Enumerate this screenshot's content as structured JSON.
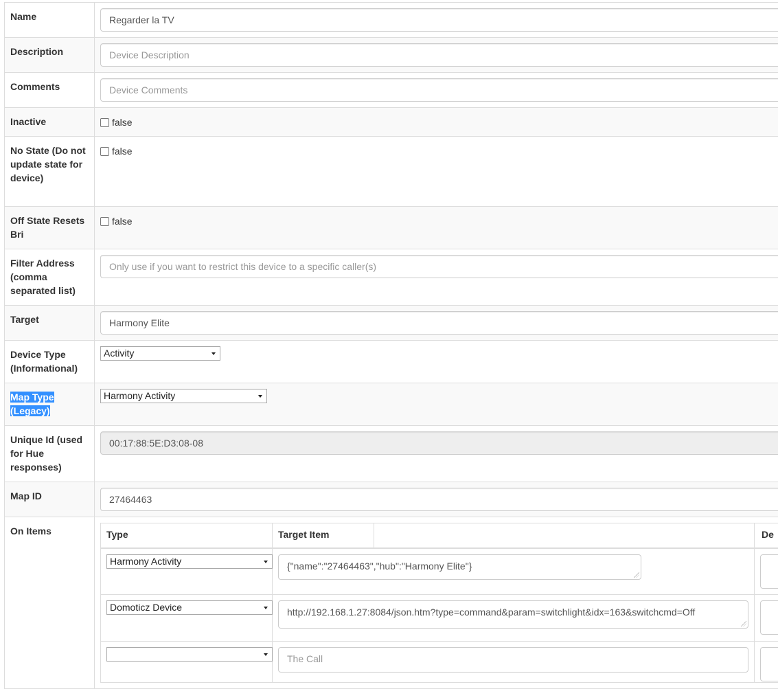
{
  "fields": {
    "name": {
      "label": "Name",
      "value": "Regarder la TV"
    },
    "description": {
      "label": "Description",
      "placeholder": "Device Description"
    },
    "comments": {
      "label": "Comments",
      "placeholder": "Device Comments"
    },
    "inactive": {
      "label": "Inactive",
      "value": "false"
    },
    "no_state": {
      "label": "No State (Do not update state for device)",
      "value": "false"
    },
    "off_state": {
      "label": "Off State Resets Bri",
      "value": "false"
    },
    "filter_address": {
      "label": "Filter Address (comma separated list)",
      "placeholder": "Only use if you want to restrict this device to a specific caller(s)"
    },
    "target": {
      "label": "Target",
      "value": "Harmony Elite"
    },
    "device_type": {
      "label": "Device Type (Informational)",
      "value": "Activity"
    },
    "map_type": {
      "label": "Map Type (Legacy)",
      "value": "Harmony Activity"
    },
    "unique_id": {
      "label": "Unique Id (used for Hue responses)",
      "value": "00:17:88:5E:D3:08-08"
    },
    "map_id": {
      "label": "Map ID",
      "value": "27464463"
    }
  },
  "on_items": {
    "label": "On Items",
    "columns": [
      "Type",
      "Target Item",
      "",
      "De"
    ],
    "rows": [
      {
        "type": "Harmony Activity",
        "target": "{\"name\":\"27464463\",\"hub\":\"Harmony Elite\"}"
      },
      {
        "type": "Domoticz Device",
        "target": "http://192.168.1.27:8084/json.htm?type=command&param=switchlight&idx=163&switchcmd=Off"
      },
      {
        "type": "",
        "target_placeholder": "The Call"
      }
    ]
  }
}
